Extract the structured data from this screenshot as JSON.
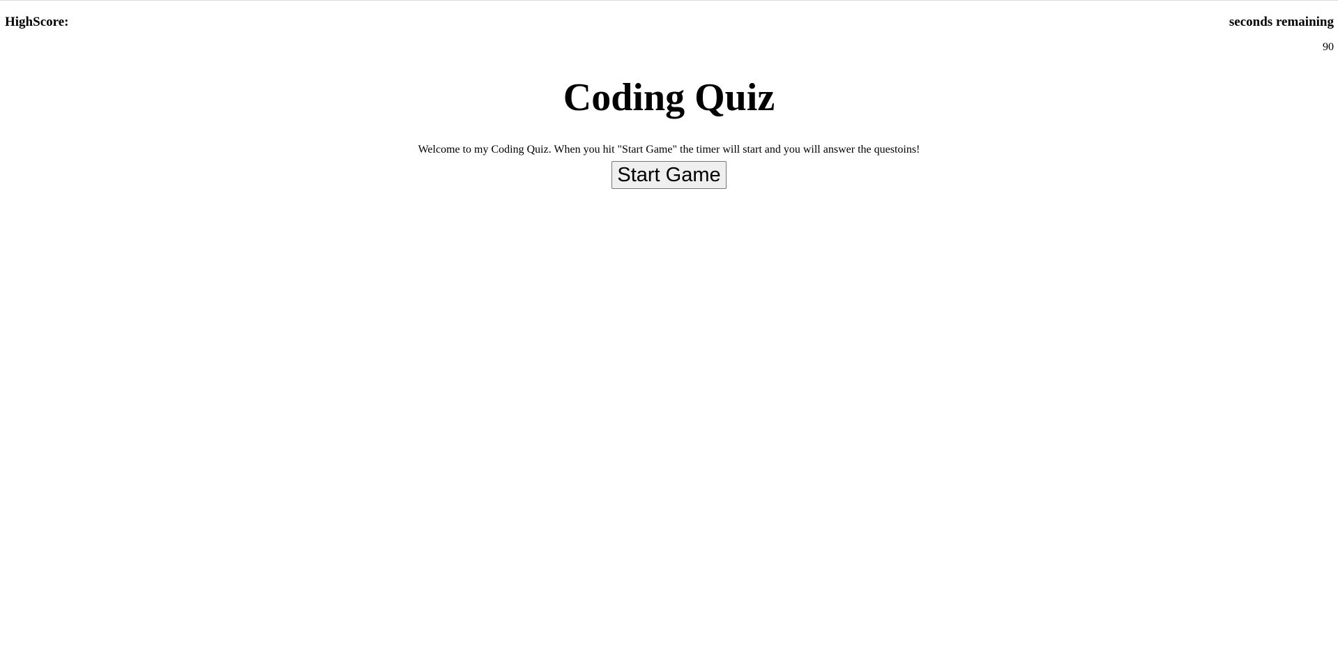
{
  "header": {
    "highscore_label": "HighScore:",
    "timer_label": "seconds remaining",
    "timer_value": "90"
  },
  "main": {
    "title": "Coding Quiz",
    "welcome_text": "Welcome to my Coding Quiz. When you hit \"Start Game\" the timer will start and you will answer the questoins!",
    "start_button_label": "Start Game"
  }
}
